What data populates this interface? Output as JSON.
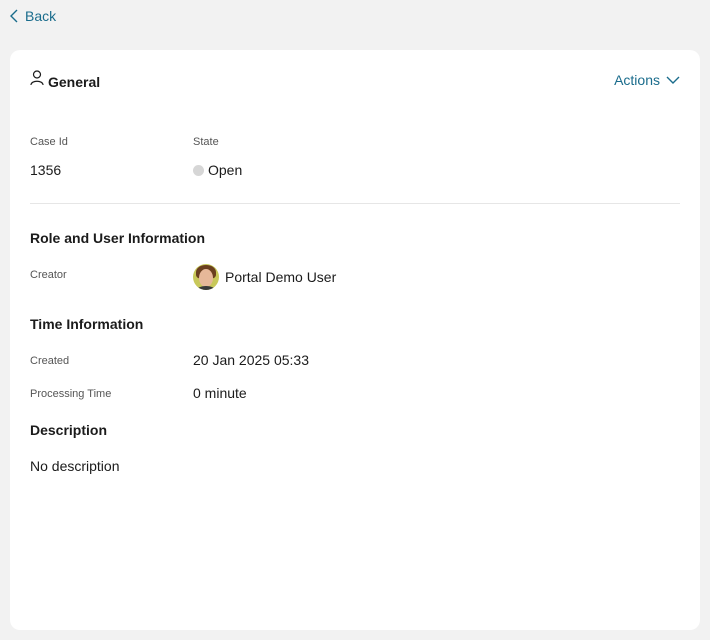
{
  "nav": {
    "back_label": "Back"
  },
  "card": {
    "title": "General",
    "actions_label": "Actions",
    "case_id": {
      "label": "Case Id",
      "value": "1356"
    },
    "state": {
      "label": "State",
      "value": "Open"
    },
    "role_section": {
      "title": "Role and User Information",
      "creator_label": "Creator",
      "creator_name": "Portal Demo User"
    },
    "time_section": {
      "title": "Time Information",
      "created_label": "Created",
      "created_value": "20 Jan 2025 05:33",
      "processing_label": "Processing Time",
      "processing_value": "0 minute"
    },
    "description_section": {
      "title": "Description",
      "value": "No description"
    }
  },
  "colors": {
    "accent": "#1a6c8c",
    "page_background": "#f2f2f2",
    "state_dot": "#d6d6d6"
  },
  "icons": {
    "back": "chevron-left-icon",
    "general": "user-icon",
    "actions": "chevron-down-icon",
    "state": "status-dot-icon"
  }
}
